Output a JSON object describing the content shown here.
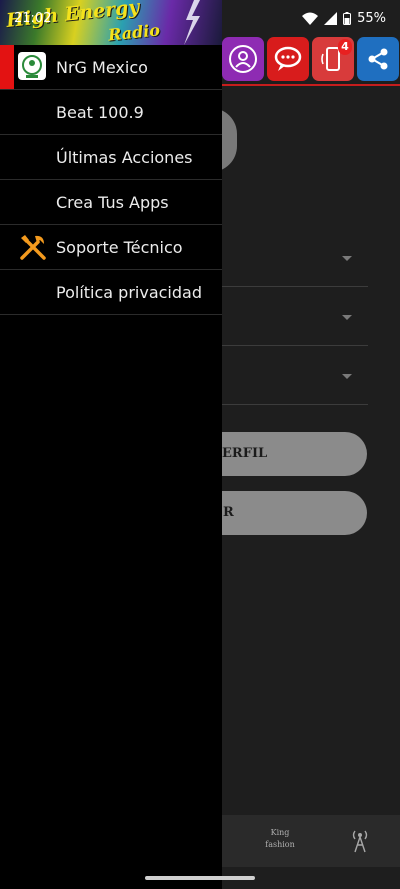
{
  "status_bar": {
    "time": "21:02",
    "battery": "55%"
  },
  "drawer": {
    "header_logo": {
      "line1": "High Energy",
      "line2": "Radio"
    },
    "items": [
      {
        "label": "NrG Mexico",
        "icon": "nrg-logo-icon",
        "active": true
      },
      {
        "label": "Beat 100.9",
        "icon": "",
        "active": false
      },
      {
        "label": "Últimas Acciones",
        "icon": "",
        "active": false
      },
      {
        "label": "Crea Tus Apps",
        "icon": "",
        "active": false
      },
      {
        "label": "Soporte Técnico",
        "icon": "tools-icon",
        "active": false
      },
      {
        "label": "Política privacidad",
        "icon": "",
        "active": false
      }
    ]
  },
  "background": {
    "top_icons": [
      {
        "name": "profile-icon",
        "color": "#8e2bb3"
      },
      {
        "name": "chat-icon",
        "color": "#d81c1c"
      },
      {
        "name": "phone-icon",
        "color": "#d83b3b",
        "badge": "4"
      },
      {
        "name": "share-icon",
        "color": "#1f6fc0"
      }
    ],
    "buttons": [
      {
        "label": "ERFIL"
      },
      {
        "label": "R"
      }
    ],
    "bottom_nav": {
      "brand_tab": "King fashion"
    }
  },
  "colors": {
    "drawer_bg": "#000000",
    "accent": "#e31212",
    "tools_icon": "#f39a1e"
  }
}
